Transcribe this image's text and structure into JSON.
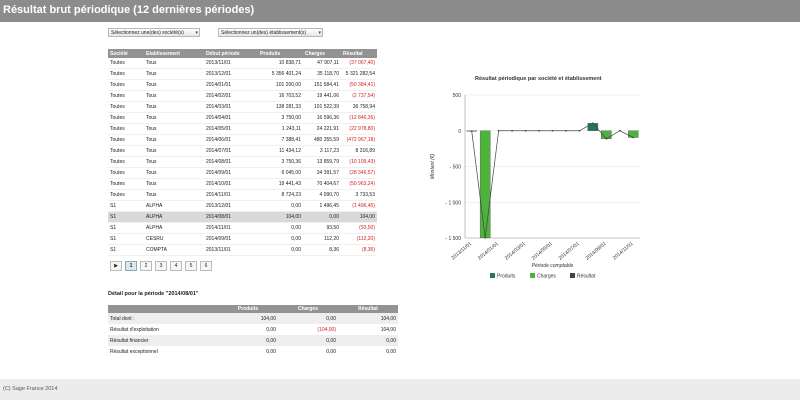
{
  "page": {
    "title": "Résultat brut périodique (12 dernières périodes)",
    "copyright": "(C) Sage France 2014"
  },
  "filters": {
    "societe": "Sélectionnez une(des) société(s)",
    "etablissement": "Sélectionnez un(des) établissement(s)"
  },
  "table": {
    "headers": [
      "Société",
      "Etablissement",
      "Début période",
      "Produits",
      "Charges",
      "Résultat"
    ],
    "rows": [
      [
        "Toutes",
        "Tous",
        "2013/11/01",
        "10 838,71",
        "47 907,11",
        "(37 067,40)"
      ],
      [
        "Toutes",
        "Tous",
        "2013/12/01",
        "5 356 401,24",
        "35 118,70",
        "5 321 282,54"
      ],
      [
        "Toutes",
        "Tous",
        "2014/01/01",
        "101 200,00",
        "151 584,41",
        "(50 384,41)"
      ],
      [
        "Toutes",
        "Tous",
        "2014/02/01",
        "16 703,52",
        "19 441,06",
        "(2 737,54)"
      ],
      [
        "Toutes",
        "Tous",
        "2014/03/01",
        "138 281,33",
        "101 522,39",
        "36 758,94"
      ],
      [
        "Toutes",
        "Tous",
        "2014/04/01",
        "3 750,00",
        "16 596,36",
        "(12 846,36)"
      ],
      [
        "Toutes",
        "Tous",
        "2014/05/01",
        "1 243,11",
        "24 221,91",
        "(22 978,80)"
      ],
      [
        "Toutes",
        "Tous",
        "2014/06/01",
        "7 388,41",
        "480 355,59",
        "(472 967,18)"
      ],
      [
        "Toutes",
        "Tous",
        "2014/07/01",
        "11 434,12",
        "3 117,23",
        "8 316,89"
      ],
      [
        "Toutes",
        "Tous",
        "2014/08/01",
        "3 750,36",
        "13 859,79",
        "(10 109,43)"
      ],
      [
        "Toutes",
        "Tous",
        "2014/09/01",
        "6 045,00",
        "34 391,57",
        "(28 346,57)"
      ],
      [
        "Toutes",
        "Tous",
        "2014/10/01",
        "19 441,43",
        "70 404,67",
        "(50 963,24)"
      ],
      [
        "Toutes",
        "Tous",
        "2014/11/01",
        "8 724,23",
        "4 990,70",
        "3 733,53"
      ],
      [
        "S1",
        "ALPHA",
        "2013/12/01",
        "0,00",
        "1 496,45",
        "(1 496,45)"
      ],
      [
        "S1",
        "ALPHA",
        "2014/08/01",
        "104,00",
        "0,00",
        "104,00"
      ],
      [
        "S1",
        "ALPHA",
        "2014/11/01",
        "0,00",
        "93,50",
        "(93,50)"
      ],
      [
        "S1",
        "CESRU",
        "2014/09/01",
        "0,00",
        "112,20",
        "(112,20)"
      ],
      [
        "S1",
        "COMPTA",
        "2013/11/01",
        "0,00",
        "8,36",
        "(8,36)"
      ]
    ],
    "selected_row": 14
  },
  "pager": {
    "pages": [
      "1",
      "2",
      "3",
      "4",
      "5",
      "6"
    ],
    "current": "1"
  },
  "detail": {
    "title": "Détail pour la période \"2014/08/01\"",
    "headers": [
      "",
      "Produits",
      "Charges",
      "Résultat"
    ],
    "rows": [
      [
        "Total dont :",
        "104,00",
        "0,00",
        "104,00"
      ],
      [
        "Résultat d'exploitation",
        "0,00",
        "(104,00)",
        "104,00"
      ],
      [
        "Résultat financier",
        "0,00",
        "0,00",
        "0,00"
      ],
      [
        "Résultat exceptionnel",
        "0,00",
        "0,00",
        "0,00"
      ]
    ]
  },
  "chart_data": {
    "type": "bar",
    "title": "Résultat périodique par société et établissement",
    "ylabel": "Montant (€)",
    "xlabel": "Période comptable",
    "categories": [
      "2013/11/01",
      "2013/12/01",
      "2014/01/01",
      "2014/02/01",
      "2014/03/01",
      "2014/04/01",
      "2014/05/01",
      "2014/06/01",
      "2014/07/01",
      "2014/08/01",
      "2014/09/01",
      "2014/10/01",
      "2014/11/01"
    ],
    "tick_labels": [
      "2013/11/01",
      "2014/01/01",
      "2014/03/01",
      "2014/05/01",
      "2014/07/01",
      "2014/09/01",
      "2014/11/01"
    ],
    "ylim": [
      -1500,
      500
    ],
    "yticks": [
      500,
      0,
      -500,
      -1000,
      -1500
    ],
    "ytick_labels": [
      "500",
      "0",
      "- 500",
      "- 1 000",
      "- 1 500"
    ],
    "series": [
      {
        "name": "Produits",
        "kind": "bar",
        "color": "#1f7a5a",
        "values": [
          0,
          0,
          0,
          0,
          0,
          0,
          0,
          0,
          0,
          104,
          0,
          0,
          0
        ]
      },
      {
        "name": "Charges",
        "kind": "bar",
        "color": "#4db33d",
        "values": [
          -8,
          -1496,
          0,
          0,
          0,
          0,
          0,
          0,
          0,
          0,
          -112,
          0,
          -94
        ]
      },
      {
        "name": "Résultat",
        "kind": "line",
        "color": "#444444",
        "values": [
          -8,
          -1496,
          0,
          0,
          0,
          0,
          0,
          0,
          0,
          104,
          -112,
          0,
          -94
        ]
      }
    ],
    "grid": true,
    "legend": "bottom"
  }
}
